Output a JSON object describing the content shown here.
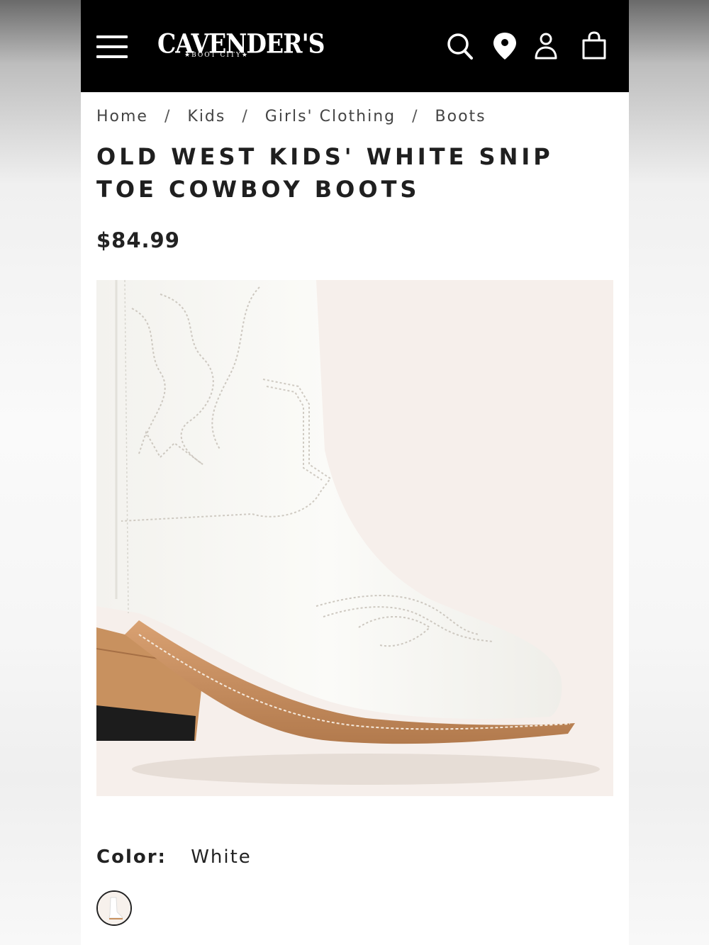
{
  "header": {
    "brand": "CAVENDER'S",
    "brand_sub": "★BOOT CITY★",
    "menu_icon": "hamburger-menu-icon",
    "icons": [
      "search-icon",
      "location-pin-icon",
      "account-icon",
      "shopping-bag-icon"
    ]
  },
  "breadcrumb": {
    "items": [
      "Home",
      "Kids",
      "Girls' Clothing",
      "Boots"
    ],
    "separator": "/"
  },
  "product": {
    "title": "OLD WEST KIDS' WHITE SNIP TOE COWBOY BOOTS",
    "price": "$84.99",
    "color_label": "Color:",
    "color_value": "White"
  },
  "colors": {
    "header_bg": "#000000",
    "image_bg": "#f6efeb",
    "text": "#1f1f1f"
  }
}
